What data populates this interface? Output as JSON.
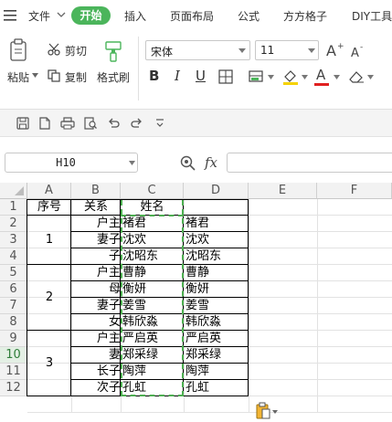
{
  "menu": {
    "file": "文件",
    "start": "开始",
    "insert": "插入",
    "page_layout": "页面布局",
    "formula": "公式",
    "fangfang": "方方格子",
    "diy": "DIY工具"
  },
  "ribbon": {
    "paste": "粘贴",
    "cut": "剪切",
    "copy": "复制",
    "format_painter": "格式刷",
    "font_name": "宋体",
    "font_size": "11",
    "bold": "B",
    "italic": "I",
    "underline": "U",
    "font_color_letter": "A"
  },
  "formula_bar": {
    "cell_ref": "H10",
    "fx": "fx",
    "formula": ""
  },
  "colors": {
    "accent": "#4bb55b",
    "copy_marquee": "#4caf50",
    "font_color": "#e02020",
    "fill_color": "#f5d200"
  },
  "grid": {
    "columns": [
      "A",
      "B",
      "C",
      "D",
      "E",
      "F"
    ],
    "rows": [
      "1",
      "2",
      "3",
      "4",
      "5",
      "6",
      "7",
      "8",
      "9",
      "10",
      "11",
      "12"
    ],
    "header": {
      "seq": "序号",
      "relation": "关系",
      "name": "姓名"
    },
    "groups": [
      "1",
      "2",
      "3"
    ],
    "relations": [
      "户主",
      "妻子",
      "子",
      "户主",
      "母",
      "妻子",
      "女",
      "户主",
      "妻",
      "长子",
      "次子"
    ],
    "names_c": [
      "褚君",
      "沈欢",
      "沈昭东",
      "曹静",
      "衡妍",
      "姜雪",
      "韩欣淼",
      "严启英",
      "郑采绿",
      "陶萍",
      "孔虹"
    ],
    "names_d": [
      "褚君",
      "沈欢",
      "沈昭东",
      "曹静",
      "衡妍",
      "姜雪",
      "韩欣淼",
      "严启英",
      "郑采绿",
      "陶萍",
      "孔虹"
    ]
  }
}
